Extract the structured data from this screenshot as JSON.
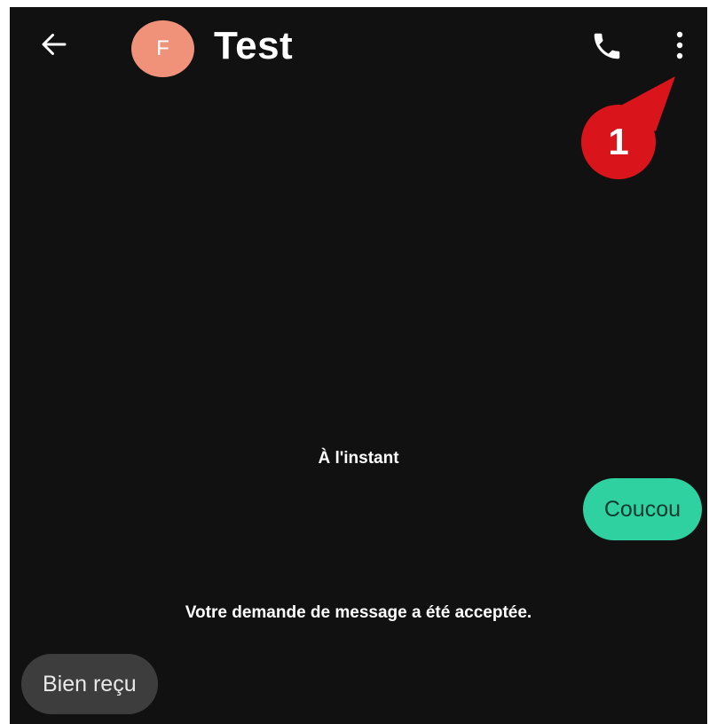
{
  "header": {
    "back_icon": "arrow-left-icon",
    "avatar_initial": "F",
    "avatar_color": "#f0917a",
    "title": "Test",
    "call_icon": "phone-icon",
    "more_icon": "more-vertical-icon"
  },
  "callout": {
    "label": "1",
    "color": "#d9141b"
  },
  "conversation": {
    "timestamp": "À l'instant",
    "outgoing": [
      {
        "text": "Coucou",
        "color": "#2fd1a0"
      }
    ],
    "system_message": "Votre demande de message a été acceptée.",
    "incoming": [
      {
        "text": "Bien reçu",
        "color": "#3d3d3d"
      }
    ]
  },
  "theme": {
    "background": "#111111",
    "text": "#ffffff"
  }
}
